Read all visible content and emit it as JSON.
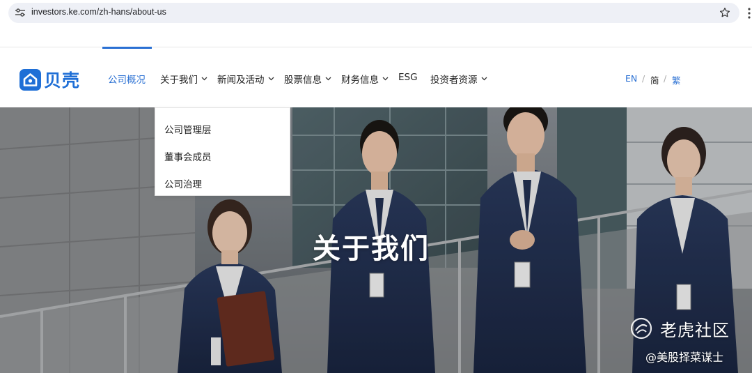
{
  "browser": {
    "url": "investors.ke.com/zh-hans/about-us",
    "icons": [
      "tune-icon",
      "bookmark-star-icon",
      "more-dots-icon"
    ]
  },
  "header": {
    "logo_text": "贝壳",
    "nav": [
      {
        "label": "公司概况",
        "active": true,
        "has_dropdown": false
      },
      {
        "label": "关于我们",
        "active": false,
        "has_dropdown": true
      },
      {
        "label": "新闻及活动",
        "active": false,
        "has_dropdown": true
      },
      {
        "label": "股票信息",
        "active": false,
        "has_dropdown": true
      },
      {
        "label": "财务信息",
        "active": false,
        "has_dropdown": true
      },
      {
        "label": "ESG",
        "active": false,
        "has_dropdown": false
      },
      {
        "label": "投资者资源",
        "active": false,
        "has_dropdown": true
      }
    ],
    "languages": {
      "en": "EN",
      "sep": "/",
      "zh_hans": "简",
      "zh_hant": "繁"
    }
  },
  "dropdown": {
    "items": [
      "公司管理层",
      "董事会成员",
      "公司治理"
    ]
  },
  "hero": {
    "title": "关于我们"
  },
  "watermark": {
    "title": "老虎社区",
    "subtitle": "@美股择菜谋士"
  },
  "colors": {
    "accent": "#2a70d3",
    "text": "#222222",
    "suit": "#1f2c4a"
  }
}
